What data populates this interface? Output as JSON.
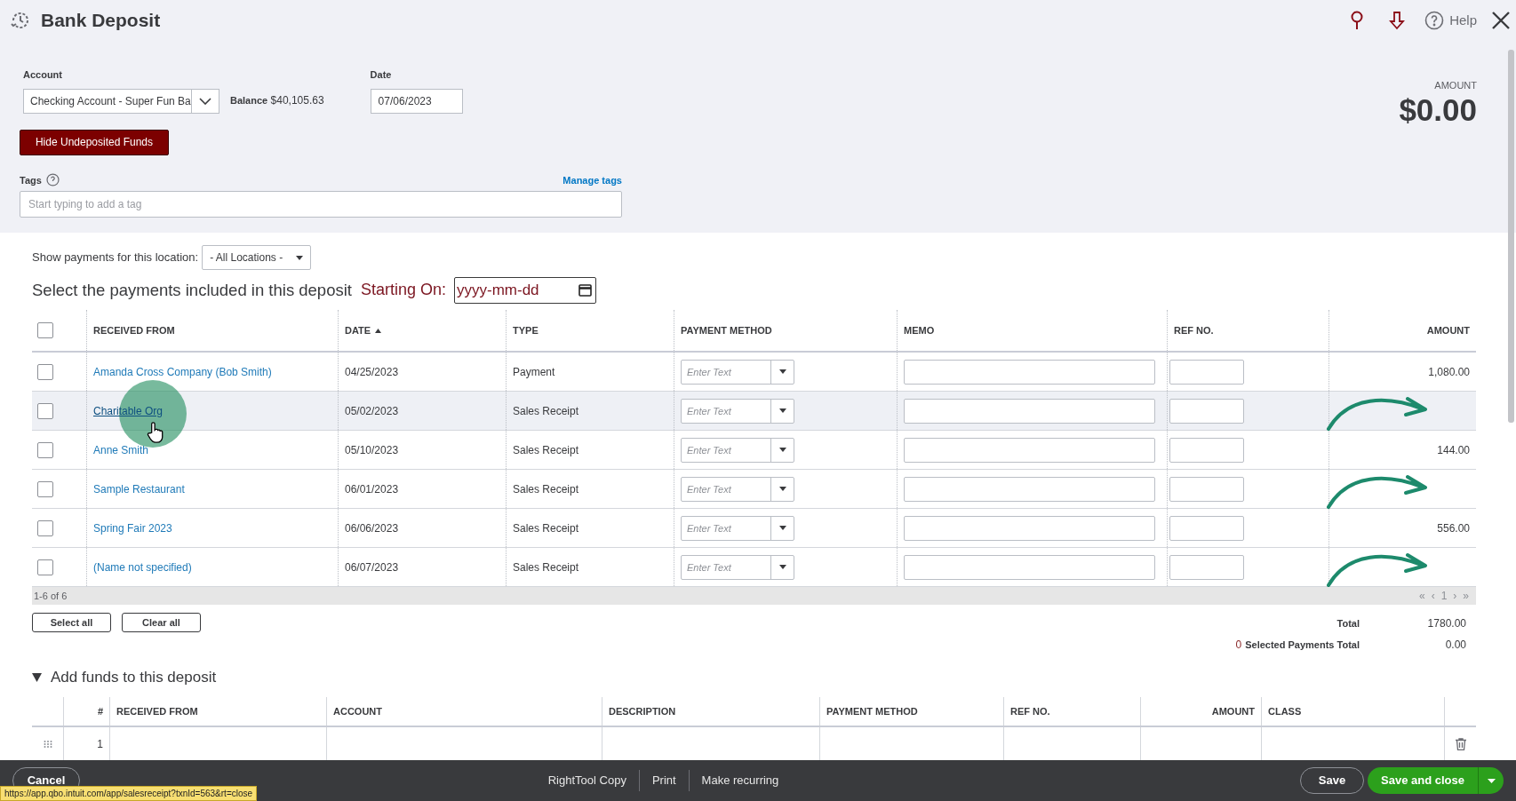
{
  "header": {
    "title": "Bank Deposit",
    "help": "Help"
  },
  "account": {
    "label": "Account",
    "value": "Checking Account - Super Fun Ba",
    "balance_label": "Balance",
    "balance": "$40,105.63"
  },
  "date": {
    "label": "Date",
    "value": "07/06/2023"
  },
  "amount": {
    "label": "AMOUNT",
    "value": "$0.00"
  },
  "hide_button": "Hide Undeposited Funds",
  "tags": {
    "label": "Tags",
    "manage": "Manage tags",
    "placeholder": "Start typing to add a tag"
  },
  "location": {
    "label": "Show payments for this location:",
    "value": "- All Locations -"
  },
  "payments": {
    "heading": "Select the payments included in this deposit",
    "starting_on_label": "Starting On:",
    "starting_on_placeholder": "yyyy-mm-dd",
    "all_checked": false,
    "columns": [
      {
        "label": "RECEIVED FROM",
        "sorted": false
      },
      {
        "label": "DATE",
        "sorted": true
      },
      {
        "label": "TYPE",
        "sorted": false
      },
      {
        "label": "PAYMENT METHOD",
        "sorted": false
      },
      {
        "label": "MEMO",
        "sorted": false
      },
      {
        "label": "REF NO.",
        "sorted": false
      },
      {
        "label": "AMOUNT",
        "sorted": false
      }
    ],
    "rows": [
      {
        "received_from": "Amanda Cross Company (Bob Smith)",
        "date": "04/25/2023",
        "type": "Payment",
        "method_placeholder": "Enter Text",
        "amount": "1,080.00",
        "checked": false,
        "hovered": false,
        "arrow": false
      },
      {
        "received_from": "Charitable Org",
        "date": "05/02/2023",
        "type": "Sales Receipt",
        "method_placeholder": "Enter Text",
        "checked": false,
        "hovered": true,
        "arrow": true
      },
      {
        "received_from": "Anne Smith",
        "date": "05/10/2023",
        "type": "Sales Receipt",
        "method_placeholder": "Enter Text",
        "amount": "144.00",
        "checked": false,
        "hovered": false,
        "arrow": false
      },
      {
        "received_from": "Sample Restaurant",
        "date": "06/01/2023",
        "type": "Sales Receipt",
        "method_placeholder": "Enter Text",
        "checked": false,
        "hovered": false,
        "arrow": true
      },
      {
        "received_from": "Spring Fair 2023",
        "date": "06/06/2023",
        "type": "Sales Receipt",
        "method_placeholder": "Enter Text",
        "amount": "556.00",
        "checked": false,
        "hovered": false,
        "arrow": false
      },
      {
        "received_from": "(Name not specified)",
        "date": "06/07/2023",
        "type": "Sales Receipt",
        "method_placeholder": "Enter Text",
        "checked": false,
        "hovered": false,
        "arrow": true
      }
    ],
    "range": "1-6 of 6",
    "pager": [
      "«",
      "‹",
      "1",
      "›",
      "»"
    ],
    "select_all": "Select all",
    "clear_all": "Clear all",
    "total_label": "Total",
    "total": "1780.00",
    "selected_count": "0",
    "selected_label": "Selected Payments Total",
    "selected_total": "0.00"
  },
  "add_funds": {
    "title": "Add funds to this deposit",
    "expanded": true,
    "columns": [
      "#",
      "RECEIVED FROM",
      "ACCOUNT",
      "DESCRIPTION",
      "PAYMENT METHOD",
      "REF NO.",
      "AMOUNT",
      "CLASS"
    ],
    "rows": [
      {
        "number": "1"
      }
    ]
  },
  "footer": {
    "cancel": "Cancel",
    "links": [
      "RightTool Copy",
      "Print",
      "Make recurring"
    ],
    "save": "Save",
    "save_close": "Save and close"
  },
  "status_url": "https://app.qbo.intuit.com/app/salesreceipt?txnId=563&rt=close"
}
